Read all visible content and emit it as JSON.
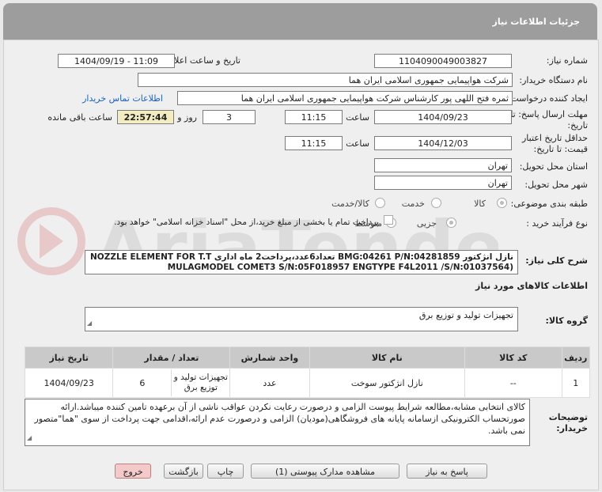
{
  "header": {
    "title": "جزئیات اطلاعات نیاز"
  },
  "form": {
    "need_number_label": "شماره نیاز:",
    "need_number": "1104090049003827",
    "announce_label": "تاریخ و ساعت اعلان عمومی:",
    "announce_value": "1404/09/19 - 11:09",
    "buyer_org_label": "نام دستگاه خریدار:",
    "buyer_org": "شرکت هواپیمایی جمهوری اسلامی ایران هما",
    "creator_label": "ایجاد کننده درخواست:",
    "creator": "ثمره فتح اللهی پور کارشناس شرکت هواپیمایی جمهوری اسلامی ایران هما",
    "contact_link": "اطلاعات تماس خریدار",
    "deadline_label_1": "مهلت ارسال پاسخ: تا",
    "deadline_label_2": "تاریخ:",
    "deadline_date": "1404/09/23",
    "time_label": "ساعت",
    "deadline_time": "11:15",
    "days_value": "3",
    "days_label": "روز و",
    "remaining_time": "22:57:44",
    "remaining_label": "ساعت باقی مانده",
    "validity_label_1": "حداقل تاریخ اعتبار",
    "validity_label_2": "قیمت: تا تاریخ:",
    "validity_date": "1404/12/03",
    "validity_time": "11:15",
    "province_label": "استان محل تحویل:",
    "province": "تهران",
    "city_label": "شهر محل تحویل:",
    "city": "تهران",
    "category_label": "طبقه بندی موضوعی:",
    "category_options": [
      "کالا",
      "خدمت",
      "کالا/خدمت"
    ],
    "category_selected": "کالا",
    "process_label": "نوع فرآیند خرید :",
    "process_options": [
      "جزیی",
      "متوسط"
    ],
    "process_selected": "جزیی",
    "payment_note": "پرداخت تمام یا بخشی از مبلغ خرید،از محل \"اسناد خزانه اسلامی\" خواهد بود."
  },
  "description": {
    "label": "شرح کلی نیاز:",
    "line1": "نازل انژکتور BMG:04261  P/N:04281859 تعداد6عدد،پرداخت2 ماه اداری NOZZLE ELEMENT FOR T.T",
    "line2": "(MULAGMODEL COMET3 S/N:05F018957 ENGTYPE F4L2011 /S/N:01037564"
  },
  "goods": {
    "section_title": "اطلاعات کالاهای مورد نیاز",
    "group_label": "گروه کالا:",
    "group_value": "تجهیزات تولید و توزیع برق",
    "columns": [
      "ردیف",
      "کد کالا",
      "نام کالا",
      "واحد شمارش",
      "تعداد / مقدار",
      "تاریخ نیاز"
    ],
    "rows": [
      {
        "index": "1",
        "code": "--",
        "name": "نازل انژکتور سوخت",
        "unit": "عدد",
        "qty_group": "تجهیزات تولید و توزیع برق",
        "qty": "6",
        "date": "1404/09/23"
      }
    ]
  },
  "buyer_notes": {
    "label_1": "توضیحات",
    "label_2": "خریدار:",
    "text": "کالای انتخابی مشابه،مطالعه شرایط پیوست الزامی و درصورت رعایت نکردن عواقب ناشی از آن برعهده تامین کننده میباشد.ارائه صورتحساب الکترونیکی ازسامانه پایانه های فروشگاهی(مودیان) الزامی و درصورت عدم ارائه،اقدامی جهت پرداخت از سوی \"هما\"متصور نمی باشد."
  },
  "buttons": {
    "reply": "پاسخ به نیاز",
    "docs": "مشاهده مدارک پیوستی (1)",
    "print": "چاپ",
    "back": "بازگشت",
    "exit": "خروج"
  }
}
